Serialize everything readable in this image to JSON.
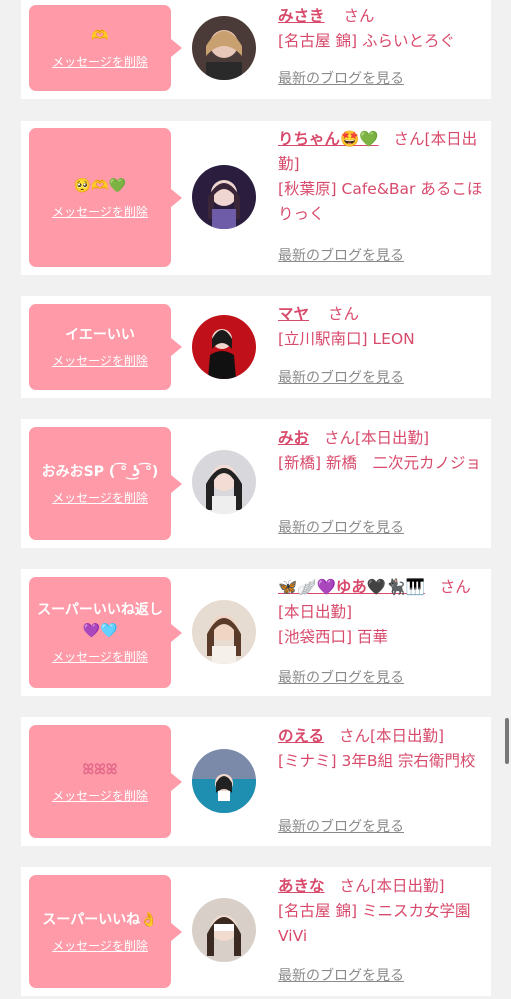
{
  "san": "さん",
  "delete_label": "メッセージを削除",
  "blog_label": "最新のブログを見る",
  "cards": [
    {
      "message": "🫶",
      "name": "みさき",
      "san_suffix": "さん",
      "shop": "[名古屋 錦] ふらいとろぐ"
    },
    {
      "message": "🥺🫶💚",
      "name": "りちゃん🤩💚",
      "san_suffix": "さん[本日出勤]",
      "shop": "[秋葉原] Cafe&Bar あるこほりっく"
    },
    {
      "message": "イエーいい",
      "name": "マヤ",
      "san_suffix": "さん",
      "shop": "[立川駅南口] LEON"
    },
    {
      "message": "おみおSP ( ͡° ͜ʖ ͡°)",
      "name": "みお",
      "san_suffix": "さん[本日出勤]",
      "shop": "[新橋] 新橋　二次元カノジョ"
    },
    {
      "message": "スーパーいいね返し💜🩵",
      "name": "🦋🪽💜ゆあ🖤🐈‍⬛🎹",
      "san_suffix": "さん[本日出勤]",
      "shop": "[池袋西口] 百華"
    },
    {
      "message": "ꕤꕤꕤ",
      "name": "のえる",
      "san_suffix": "さん[本日出勤]",
      "shop": "[ミナミ] 3年B組 宗右衛門校"
    },
    {
      "message": "スーパーいいね👌",
      "name": "あきな",
      "san_suffix": "さん[本日出勤]",
      "shop": "[名古屋 錦] ミニスカ女学園ViVi"
    }
  ],
  "colors": {
    "bubble": "#ff9aa8",
    "accent": "#d84a6b",
    "muted": "#8a8a8a"
  }
}
